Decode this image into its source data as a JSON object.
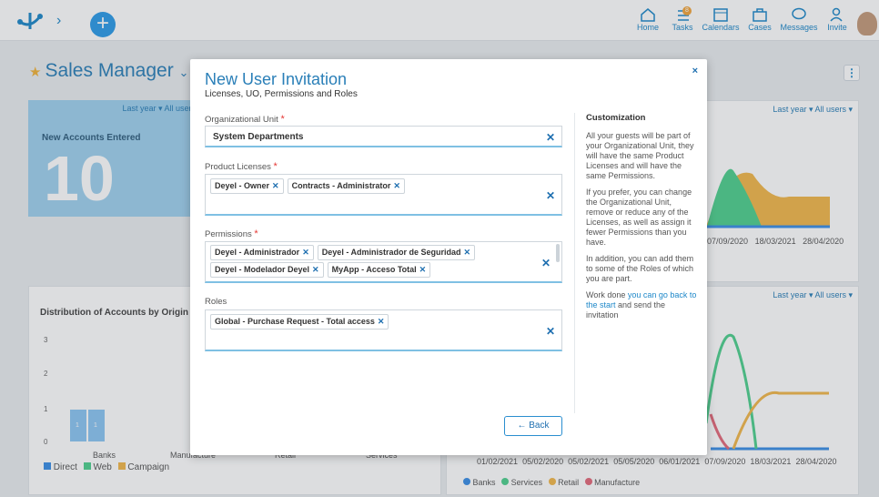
{
  "nav": {
    "home": "Home",
    "tasks": "Tasks",
    "tasks_badge": "8",
    "calendars": "Calendars",
    "cases": "Cases",
    "messages": "Messages",
    "invite": "Invite"
  },
  "page": {
    "title": "Sales Manager"
  },
  "kpi": {
    "filter": "Last year ▾  All users",
    "label": "New Accounts Entered",
    "value": "10"
  },
  "right_top": {
    "filter": "Last year ▾  All users ▾",
    "xticks": [
      "07/09/2020",
      "18/03/2021",
      "28/04/2020"
    ]
  },
  "distribution": {
    "title": "Distribution of Accounts by Origin",
    "yticks": [
      "3",
      "2",
      "1",
      "0"
    ],
    "categories": [
      "Banks",
      "Manufacture",
      "Retail",
      "Services"
    ],
    "bar_labels": [
      "1",
      "1"
    ],
    "legend": [
      "Direct",
      "Web",
      "Campaign"
    ],
    "legend_colors": [
      "#3a8ee6",
      "#4fd08e",
      "#f2b84b"
    ]
  },
  "right_bottom": {
    "filter": "Last year ▾  All users ▾",
    "xticks": [
      "01/02/2021",
      "05/02/2020",
      "05/02/2021",
      "05/05/2020",
      "06/01/2021",
      "07/09/2020",
      "18/03/2021",
      "28/04/2020"
    ],
    "legend": [
      "Banks",
      "Services",
      "Retail",
      "Manufacture"
    ],
    "legend_colors": [
      "#3a8ee6",
      "#4fd08e",
      "#f2b84b",
      "#e36a7a"
    ]
  },
  "modal": {
    "title": "New User Invitation",
    "subtitle": "Licenses, UO, Permissions and Roles",
    "close": "×",
    "org_unit": {
      "label": "Organizational Unit",
      "value": "System Departments"
    },
    "licenses": {
      "label": "Product Licenses",
      "chips": [
        "Deyel - Owner",
        "Contracts - Administrator"
      ]
    },
    "permissions": {
      "label": "Permissions",
      "chips": [
        "Deyel - Administrador",
        "Deyel - Administrador de Seguridad",
        "Deyel - Modelador Deyel",
        "MyApp - Acceso Total"
      ]
    },
    "roles": {
      "label": "Roles",
      "chips": [
        "Global - Purchase Request - Total access"
      ]
    },
    "side": {
      "heading": "Customization",
      "p1": "All your guests will be part of your Organizational Unit, they will have the same Product Licenses and will have the same Permissions.",
      "p2": "If you prefer, you can change the Organizational Unit, remove or reduce any of the Licenses, as well as assign it fewer Permissions than you have.",
      "p3": "In addition, you can add them to some of the Roles of which you are part.",
      "p4a": "Work done ",
      "p4link": "you can go back to the start",
      "p4b": " and send the invitation"
    },
    "back": "Back"
  }
}
